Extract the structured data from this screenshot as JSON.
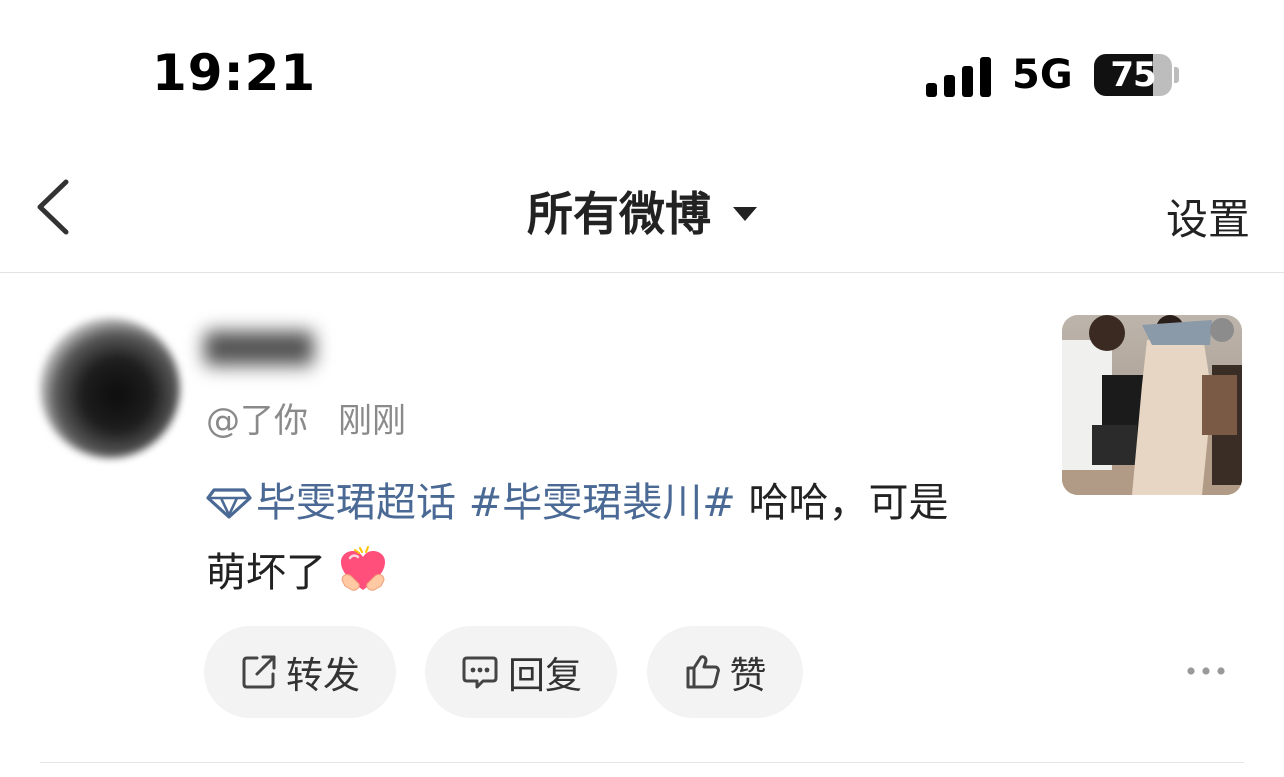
{
  "status_bar": {
    "time": "19:21",
    "network": "5G",
    "battery_level": 75,
    "battery_text": "75"
  },
  "nav": {
    "title": "所有微博",
    "settings_label": "设置"
  },
  "post": {
    "username": " ",
    "mention": "@了你",
    "timestamp": "刚刚",
    "supertopic": "毕雯珺超话",
    "hashtag": "#毕雯珺裴川#",
    "text_1": " 哈哈，可是",
    "text_2": "萌坏了",
    "emoji": "heart-hands-emoji"
  },
  "actions": {
    "repost_label": "转发",
    "reply_label": "回复",
    "like_label": "赞"
  },
  "icons": {
    "back": "chevron-left-icon",
    "dropdown": "caret-down-icon",
    "supertopic": "diamond-icon",
    "repost": "share-icon",
    "reply": "comment-icon",
    "like": "thumbs-up-icon",
    "more": "more-dots-icon"
  },
  "colors": {
    "topic_link": "#4a6994",
    "button_bg": "#f3f3f3"
  }
}
